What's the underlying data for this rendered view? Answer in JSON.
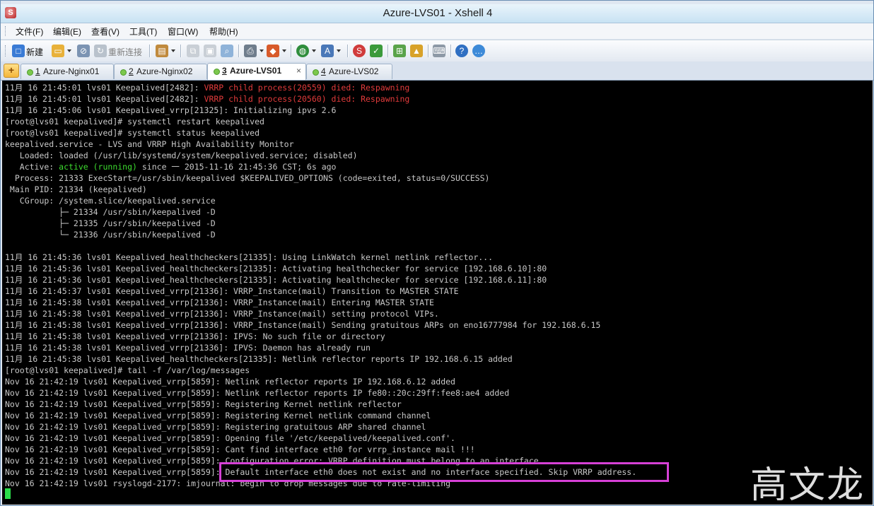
{
  "window": {
    "title": "Azure-LVS01 - Xshell 4",
    "app_icon": "xshell-icon"
  },
  "menu": [
    "文件(F)",
    "编辑(E)",
    "查看(V)",
    "工具(T)",
    "窗口(W)",
    "帮助(H)"
  ],
  "toolbar": {
    "new_label": "新建",
    "reconnect_label": "重新连接"
  },
  "tabs": [
    {
      "num": "1",
      "name": "Azure-Nginx01",
      "active": false
    },
    {
      "num": "2",
      "name": "Azure-Nginx02",
      "active": false
    },
    {
      "num": "3",
      "name": "Azure-LVS01",
      "active": true,
      "close": "×"
    },
    {
      "num": "4",
      "name": "Azure-LVS02",
      "active": false
    }
  ],
  "terminal": {
    "lines": [
      [
        {
          "t": "11月 16 21:45:01 lvs01 Keepalived[2482]: "
        },
        {
          "t": "VRRP child process(20559) died: Respawning",
          "c": "red"
        }
      ],
      [
        {
          "t": "11月 16 21:45:01 lvs01 Keepalived[2482]: "
        },
        {
          "t": "VRRP child process(20560) died: Respawning",
          "c": "red"
        }
      ],
      [
        {
          "t": "11月 16 21:45:06 lvs01 Keepalived_vrrp[21325]: Initializing ipvs 2.6"
        }
      ],
      [
        {
          "t": "[root@lvs01 keepalived]# systemctl restart keepalived"
        }
      ],
      [
        {
          "t": "[root@lvs01 keepalived]# systemctl status keepalived"
        }
      ],
      [
        {
          "t": "keepalived.service - LVS and VRRP High Availability Monitor"
        }
      ],
      [
        {
          "t": "   Loaded: loaded (/usr/lib/systemd/system/keepalived.service; disabled)"
        }
      ],
      [
        {
          "t": "   Active: "
        },
        {
          "t": "active (running)",
          "c": "green"
        },
        {
          "t": " since 一 2015-11-16 21:45:36 CST; 6s ago"
        }
      ],
      [
        {
          "t": "  Process: 21333 ExecStart=/usr/sbin/keepalived $KEEPALIVED_OPTIONS (code=exited, status=0/SUCCESS)"
        }
      ],
      [
        {
          "t": " Main PID: 21334 (keepalived)"
        }
      ],
      [
        {
          "t": "   CGroup: /system.slice/keepalived.service"
        }
      ],
      [
        {
          "t": "           ├─ 21334 /usr/sbin/keepalived -D"
        }
      ],
      [
        {
          "t": "           ├─ 21335 /usr/sbin/keepalived -D"
        }
      ],
      [
        {
          "t": "           └─ 21336 /usr/sbin/keepalived -D"
        }
      ],
      [
        {
          "t": ""
        }
      ],
      [
        {
          "t": "11月 16 21:45:36 lvs01 Keepalived_healthcheckers[21335]: Using LinkWatch kernel netlink reflector..."
        }
      ],
      [
        {
          "t": "11月 16 21:45:36 lvs01 Keepalived_healthcheckers[21335]: Activating healthchecker for service [192.168.6.10]:80"
        }
      ],
      [
        {
          "t": "11月 16 21:45:36 lvs01 Keepalived_healthcheckers[21335]: Activating healthchecker for service [192.168.6.11]:80"
        }
      ],
      [
        {
          "t": "11月 16 21:45:37 lvs01 Keepalived_vrrp[21336]: VRRP_Instance(mail) Transition to MASTER STATE"
        }
      ],
      [
        {
          "t": "11月 16 21:45:38 lvs01 Keepalived_vrrp[21336]: VRRP_Instance(mail) Entering MASTER STATE"
        }
      ],
      [
        {
          "t": "11月 16 21:45:38 lvs01 Keepalived_vrrp[21336]: VRRP_Instance(mail) setting protocol VIPs."
        }
      ],
      [
        {
          "t": "11月 16 21:45:38 lvs01 Keepalived_vrrp[21336]: VRRP_Instance(mail) Sending gratuitous ARPs on eno16777984 for 192.168.6.15"
        }
      ],
      [
        {
          "t": "11月 16 21:45:38 lvs01 Keepalived_vrrp[21336]: IPVS: No such file or directory"
        }
      ],
      [
        {
          "t": "11月 16 21:45:38 lvs01 Keepalived_vrrp[21336]: IPVS: Daemon has already run"
        }
      ],
      [
        {
          "t": "11月 16 21:45:38 lvs01 Keepalived_healthcheckers[21335]: Netlink reflector reports IP 192.168.6.15 added"
        }
      ],
      [
        {
          "t": "[root@lvs01 keepalived]# tail -f /var/log/messages"
        }
      ],
      [
        {
          "t": "Nov 16 21:42:19 lvs01 Keepalived_vrrp[5859]: Netlink reflector reports IP 192.168.6.12 added"
        }
      ],
      [
        {
          "t": "Nov 16 21:42:19 lvs01 Keepalived_vrrp[5859]: Netlink reflector reports IP fe80::20c:29ff:fee8:ae4 added"
        }
      ],
      [
        {
          "t": "Nov 16 21:42:19 lvs01 Keepalived_vrrp[5859]: Registering Kernel netlink reflector"
        }
      ],
      [
        {
          "t": "Nov 16 21:42:19 lvs01 Keepalived_vrrp[5859]: Registering Kernel netlink command channel"
        }
      ],
      [
        {
          "t": "Nov 16 21:42:19 lvs01 Keepalived_vrrp[5859]: Registering gratuitous ARP shared channel"
        }
      ],
      [
        {
          "t": "Nov 16 21:42:19 lvs01 Keepalived_vrrp[5859]: Opening file '/etc/keepalived/keepalived.conf'."
        }
      ],
      [
        {
          "t": "Nov 16 21:42:19 lvs01 Keepalived_vrrp[5859]: Cant find interface eth0 for vrrp_instance mail !!!"
        }
      ],
      [
        {
          "t": "Nov 16 21:42:19 lvs01 Keepalived_vrrp[5859]: Configuration error: VRRP definition must belong to an interface"
        }
      ],
      [
        {
          "t": "Nov 16 21:42:19 lvs01 Keepalived_vrrp[5859]: Default interface eth0 does not exist and no interface specified. Skip VRRP address."
        }
      ],
      [
        {
          "t": "Nov 16 21:42:19 lvs01 rsyslogd-2177: imjournal: begin to drop messages due to rate-limiting"
        }
      ]
    ],
    "highlighted_line": 34,
    "highlight_color": "#d640d6"
  },
  "watermark": "高文龙",
  "colors": {
    "terminal_bg": "#000000",
    "terminal_fg": "#c8c8c8",
    "error_red": "#e23b3b",
    "active_green": "#3ddc2f",
    "cursor_green": "#2bdc4a"
  }
}
